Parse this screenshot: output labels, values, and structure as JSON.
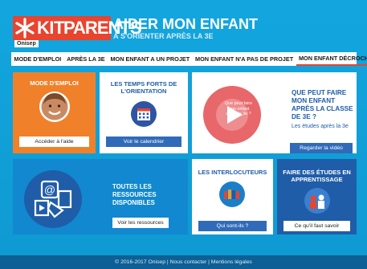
{
  "header": {
    "logo_kit": "KIT",
    "logo_parents": "PARENTS",
    "logo_onisep": "Onisep",
    "title_line1": "AIDER MON ENFANT",
    "title_line2": "À S'ORIENTER APRÈS LA 3E"
  },
  "nav": {
    "items": [
      {
        "label": "MODE D'EMPLOI"
      },
      {
        "label": "APRÈS LA 3E"
      },
      {
        "label": "MON ENFANT A UN PROJET"
      },
      {
        "label": "MON ENFANT N'A PAS DE PROJET"
      },
      {
        "label": "MON ENFANT DÉCROCHE"
      }
    ],
    "active_index": 4
  },
  "tiles": {
    "mode": {
      "title": "MODE D'EMPLOI",
      "button": "Accéder à l'aide"
    },
    "temps": {
      "title": "LES TEMPS FORTS DE L'ORIENTATION",
      "button": "Voir le calendrier"
    },
    "video": {
      "thumb_text": "Que peut faire mon enfant après la 3e ?",
      "title": "QUE PEUT FAIRE MON ENFANT APRÈS LA CLASSE DE 3E ?",
      "subtitle": "Les études après la 3e",
      "button": "Regarder la vidéo"
    },
    "ressources": {
      "title": "TOUTES LES RESSOURCES DISPONIBLES",
      "button": "Voir les ressources"
    },
    "interlocuteurs": {
      "title": "LES INTERLOCUTEURS",
      "button": "Qui sont-ils ?"
    },
    "apprentissage": {
      "title": "FAIRE DES ÉTUDES EN APPRENTISSAGE",
      "button": "Ce qu'il faut savoir"
    }
  },
  "footer": {
    "text": "© 2016-2017 Onisep | Nous contacter | Mentions légales"
  },
  "colors": {
    "brand_red": "#e8442e",
    "orange": "#f0812a",
    "blue": "#1188cf",
    "dark_blue": "#1f5da8",
    "background": "#12a1da"
  }
}
